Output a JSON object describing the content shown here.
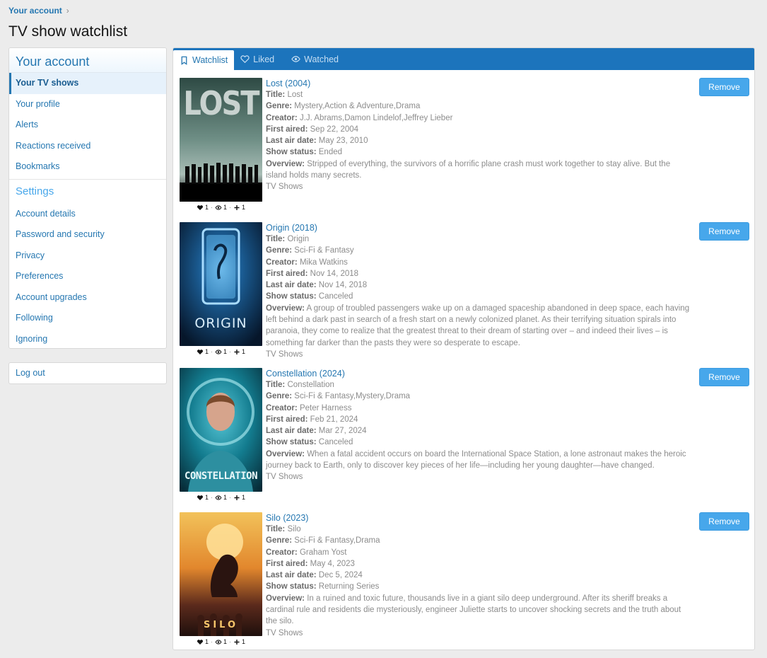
{
  "breadcrumb": {
    "label": "Your account"
  },
  "page_title": "TV show watchlist",
  "sidebar": {
    "header": "Your account",
    "items": [
      {
        "label": "Your TV shows"
      },
      {
        "label": "Your profile"
      },
      {
        "label": "Alerts"
      },
      {
        "label": "Reactions received"
      },
      {
        "label": "Bookmarks"
      }
    ],
    "settings_header": "Settings",
    "settings_items": [
      {
        "label": "Account details"
      },
      {
        "label": "Password and security"
      },
      {
        "label": "Privacy"
      },
      {
        "label": "Preferences"
      },
      {
        "label": "Account upgrades"
      },
      {
        "label": "Following"
      },
      {
        "label": "Ignoring"
      }
    ],
    "logout": "Log out"
  },
  "tabs": [
    {
      "label": "Watchlist",
      "icon": "bookmark-icon"
    },
    {
      "label": "Liked",
      "icon": "heart-icon"
    },
    {
      "label": "Watched",
      "icon": "eye-icon"
    }
  ],
  "labels": {
    "title": "Title:",
    "genre": "Genre:",
    "creator": "Creator:",
    "first_aired": "First aired:",
    "last_air_date": "Last air date:",
    "show_status": "Show status:",
    "overview": "Overview:",
    "remove": "Remove"
  },
  "colors": {
    "accent": "#1c74bc",
    "link": "#2577b1",
    "button": "#47a7eb"
  },
  "shows": [
    {
      "heading": "Lost (2004)",
      "title": "Lost",
      "genre": "Mystery,Action & Adventure,Drama",
      "creator": "J.J. Abrams,Damon Lindelof,Jeffrey Lieber",
      "first_aired": "Sep 22, 2004",
      "last_air_date": "May 23, 2010",
      "show_status": "Ended",
      "overview": "Stripped of everything, the survivors of a horrific plane crash must work together to stay alive. But the island holds many secrets.",
      "category": "TV Shows",
      "poster_text": "LOST",
      "likes": "1",
      "views": "1",
      "adds": "1"
    },
    {
      "heading": "Origin (2018)",
      "title": "Origin",
      "genre": "Sci-Fi & Fantasy",
      "creator": "Mika Watkins",
      "first_aired": "Nov 14, 2018",
      "last_air_date": "Nov 14, 2018",
      "show_status": "Canceled",
      "overview": "A group of troubled passengers wake up on a damaged spaceship abandoned in deep space, each having left behind a dark past in search of a fresh start on a newly colonized planet. As their terrifying situation spirals into paranoia, they come to realize that the greatest threat to their dream of starting over – and indeed their lives – is something far darker than the pasts they were so desperate to escape.",
      "category": "TV Shows",
      "poster_text": "ORIGIN",
      "likes": "1",
      "views": "1",
      "adds": "1"
    },
    {
      "heading": "Constellation (2024)",
      "title": "Constellation",
      "genre": "Sci-Fi & Fantasy,Mystery,Drama",
      "creator": "Peter Harness",
      "first_aired": "Feb 21, 2024",
      "last_air_date": "Mar 27, 2024",
      "show_status": "Canceled",
      "overview": "When a fatal accident occurs on board the International Space Station, a lone astronaut makes the heroic journey back to Earth, only to discover key pieces of her life—including her young daughter—have changed.",
      "category": "TV Shows",
      "poster_text": "CONSTELLATION",
      "likes": "1",
      "views": "1",
      "adds": "1"
    },
    {
      "heading": "Silo (2023)",
      "title": "Silo",
      "genre": "Sci-Fi & Fantasy,Drama",
      "creator": "Graham Yost",
      "first_aired": "May 4, 2023",
      "last_air_date": "Dec 5, 2024",
      "show_status": "Returning Series",
      "overview": "In a ruined and toxic future, thousands live in a giant silo deep underground. After its sheriff breaks a cardinal rule and residents die mysteriously, engineer Juliette starts to uncover shocking secrets and the truth about the silo.",
      "category": "TV Shows",
      "poster_text": "SILO",
      "likes": "1",
      "views": "1",
      "adds": "1"
    }
  ]
}
